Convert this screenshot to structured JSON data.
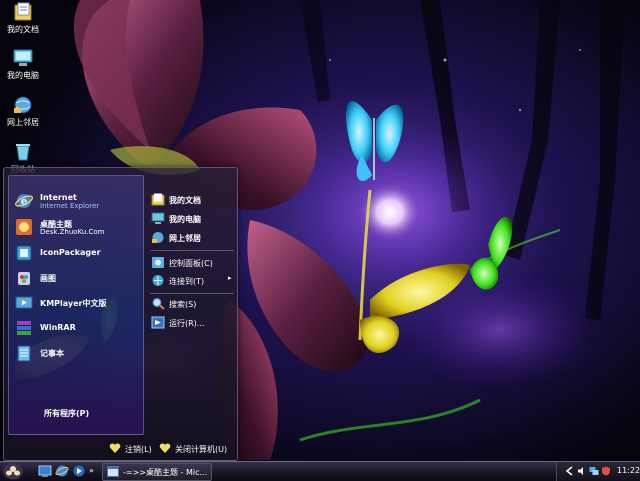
{
  "desktop": {
    "icons": [
      {
        "label": "我的文档",
        "icon": "my-documents-icon"
      },
      {
        "label": "我的电脑",
        "icon": "my-computer-icon"
      },
      {
        "label": "网上邻居",
        "icon": "network-places-icon"
      },
      {
        "label": "回收站",
        "icon": "recycle-bin-icon"
      }
    ]
  },
  "start_menu": {
    "programs": [
      {
        "name": "Internet",
        "sub": "Internet Explorer",
        "icon": "internet-explorer-icon"
      },
      {
        "name": "桌酷主题",
        "sub": "Desk.ZhuoKu.Com",
        "icon": "zhuoku-theme-icon"
      },
      {
        "name": "IconPackager",
        "sub": "",
        "icon": "iconpackager-icon"
      },
      {
        "name": "画图",
        "sub": "",
        "icon": "paint-icon"
      },
      {
        "name": "KMPlayer中文版",
        "sub": "",
        "icon": "kmplayer-icon"
      },
      {
        "name": "WinRAR",
        "sub": "",
        "icon": "winrar-icon"
      },
      {
        "name": "记事本",
        "sub": "",
        "icon": "notepad-icon"
      }
    ],
    "all_programs": "所有程序(P)",
    "places": [
      {
        "label": "我的文档",
        "icon": "my-documents-icon"
      },
      {
        "label": "我的电脑",
        "icon": "my-computer-icon"
      },
      {
        "label": "网上邻居",
        "icon": "network-places-icon"
      },
      {
        "label": "控制面板(C)",
        "icon": "control-panel-icon"
      },
      {
        "label": "连接到(T)",
        "icon": "connect-to-icon"
      },
      {
        "label": "搜索(S)",
        "icon": "search-icon"
      },
      {
        "label": "运行(R)...",
        "icon": "run-icon"
      }
    ],
    "connect_arrow": "▸",
    "log_off": "注销(L)",
    "shut_down": "关闭计算机(U)"
  },
  "taskbar": {
    "more": "»",
    "task_label": "-=>>桌酷主题 - Mic...",
    "clock": "11:22"
  },
  "colors": {
    "taskbar_bg": "#17141f",
    "menu_bg": "#282038",
    "left_pane_accent": "#3c3ca0",
    "link_sub": "#9fc4ff"
  }
}
